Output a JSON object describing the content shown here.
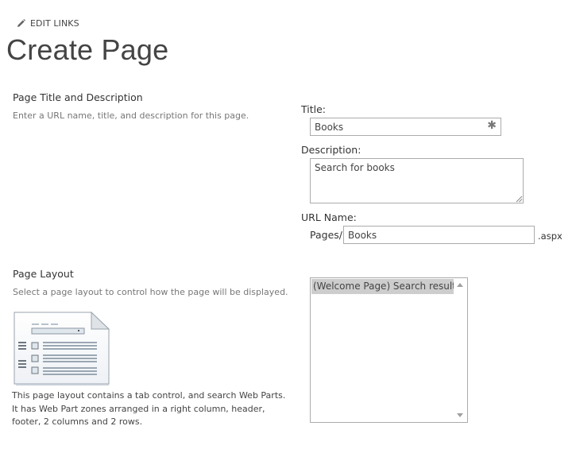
{
  "header": {
    "edit_links_label": "EDIT LINKS",
    "page_title": "Create Page"
  },
  "page_title_section": {
    "heading": "Page Title and Description",
    "description": "Enter a URL name, title, and description for this page.",
    "title_label": "Title:",
    "title_value": "Books",
    "description_label": "Description:",
    "description_value": "Search for books",
    "url_name_label": "URL Name:",
    "url_prefix": "Pages/",
    "url_value": "Books",
    "url_suffix": ".aspx"
  },
  "page_layout_section": {
    "heading": "Page Layout",
    "description": "Select a page layout to control how the page will be displayed.",
    "options": [
      "(Welcome Page) Search results"
    ],
    "selected_option": "(Welcome Page) Search results",
    "layout_description": "This page layout contains a tab control, and search Web Parts. It has Web Part zones arranged in a right column, header, footer, 2 columns and 2 rows."
  },
  "colors": {
    "text": "#444444",
    "muted": "#777777",
    "border": "#ababab",
    "selected_bg": "#cdcdcd"
  },
  "icons": {
    "edit_links": "pencil-icon",
    "required": "asterisk-icon",
    "layout_preview": "page-layout-preview-icon"
  }
}
